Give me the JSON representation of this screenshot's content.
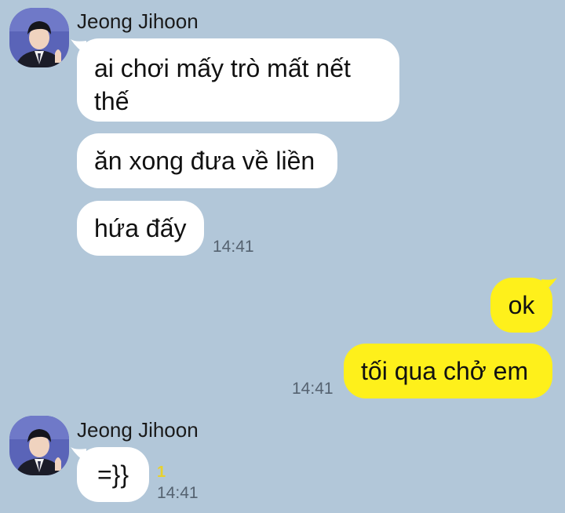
{
  "colors": {
    "background": "#b2c7d9",
    "incoming_bubble": "#ffffff",
    "outgoing_bubble": "#fef01b",
    "unread_count": "#e8d12c",
    "timestamp": "#556270"
  },
  "messages": {
    "group1": {
      "sender": "Jeong Jihoon",
      "avatar_icon": "profile-photo-icon",
      "bubble1": "ai chơi mấy trò mất nết thế",
      "bubble2": "ăn xong đưa về liền",
      "bubble3": "hứa đấy",
      "time": "14:41"
    },
    "group2": {
      "bubble1": "ok",
      "bubble2": "tối qua chở em",
      "time": "14:41"
    },
    "group3": {
      "sender": "Jeong Jihoon",
      "avatar_icon": "profile-photo-icon",
      "bubble1": "=}}",
      "unread": "1",
      "time": "14:41"
    }
  }
}
